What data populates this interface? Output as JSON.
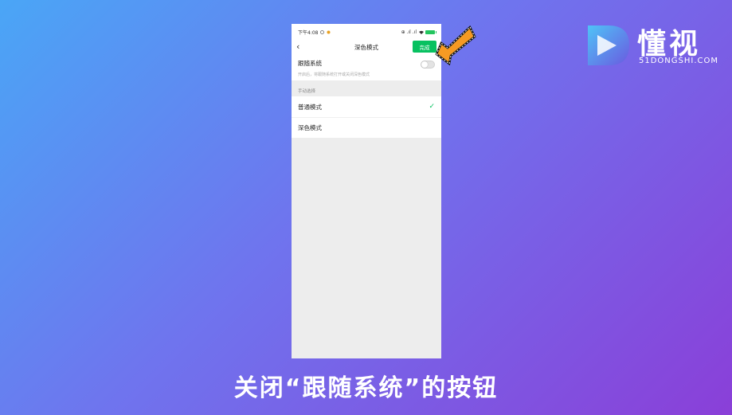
{
  "status_bar": {
    "time": "下午4:08",
    "right_text": "⊕ .ıl .ıl"
  },
  "header": {
    "back_label": "‹",
    "title": "深色模式",
    "done_label": "完成"
  },
  "follow_system": {
    "title": "跟随系统",
    "description": "开启后，将跟随系统打开或关闭深色模式",
    "enabled": false
  },
  "manual": {
    "section_label": "手动选择",
    "options": [
      {
        "label": "普通模式",
        "selected": true
      },
      {
        "label": "深色模式",
        "selected": false
      }
    ]
  },
  "logo": {
    "name": "懂视",
    "url_text": "51DONGSHI.COM"
  },
  "caption": "关闭“跟随系统”的按钮",
  "colors": {
    "accent": "#07c160",
    "arrow": "#f59a23"
  }
}
